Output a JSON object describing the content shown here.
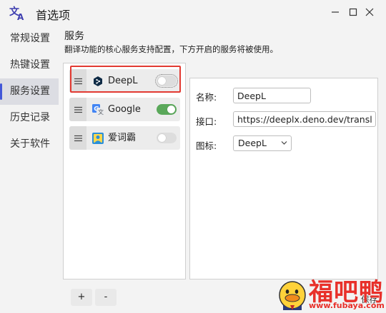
{
  "window": {
    "title": "首选项"
  },
  "sidebar": {
    "items": [
      {
        "label": "常规设置"
      },
      {
        "label": "热键设置"
      },
      {
        "label": "服务设置",
        "active": true
      },
      {
        "label": "历史记录"
      },
      {
        "label": "关于软件"
      }
    ]
  },
  "header": {
    "title": "服务",
    "description": "翻译功能的核心服务支持配置，下方开启的服务将被使用。"
  },
  "services": [
    {
      "name": "DeepL",
      "icon": "deepl-icon",
      "enabled": false,
      "selected": true
    },
    {
      "name": "Google",
      "icon": "google-translate-icon",
      "enabled": true
    },
    {
      "name": "爱词霸",
      "icon": "iciba-icon",
      "enabled": false
    }
  ],
  "detail": {
    "name_label": "名称:",
    "name_value": "DeepL",
    "endpoint_label": "接口:",
    "endpoint_value": "https://deeplx.deno.dev/translate",
    "icon_label": "图标:",
    "icon_value": "DeepL"
  },
  "buttons": {
    "add": "+",
    "remove": "-",
    "save": "保存"
  },
  "watermark": {
    "text": "福吧鸭",
    "url": "www.fubaya.com"
  },
  "colors": {
    "accent": "#4257d8",
    "toggle_on": "#5aa85a",
    "highlight": "#e23a32",
    "watermark": "#e8302a"
  }
}
